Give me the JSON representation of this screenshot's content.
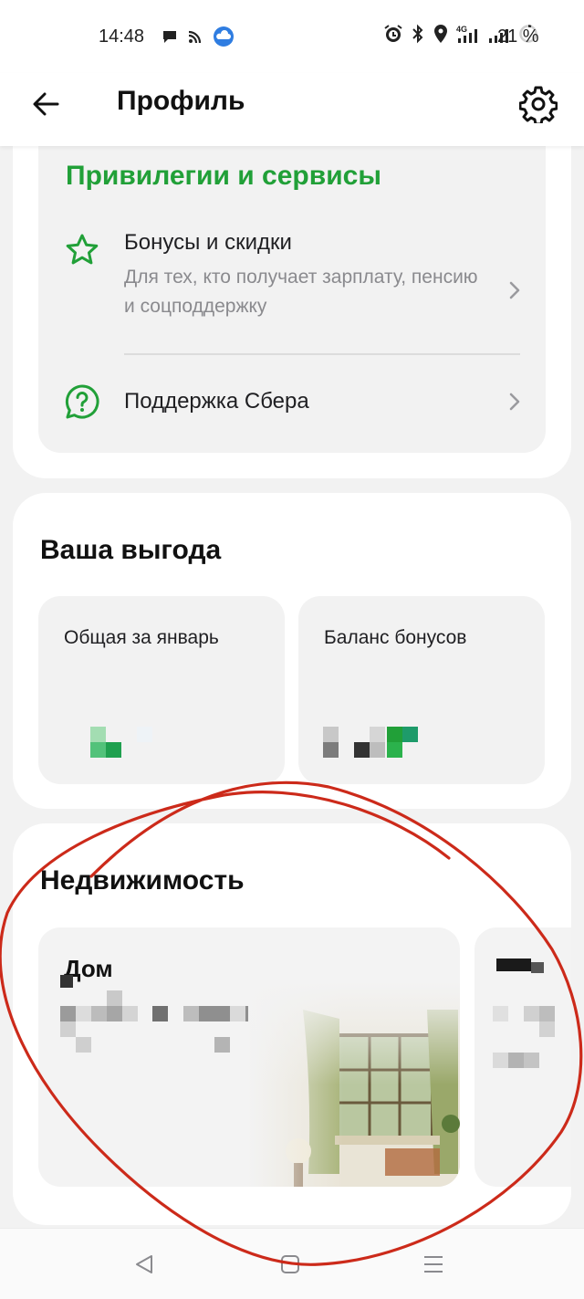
{
  "status_bar": {
    "time": "14:48",
    "battery": "21 %",
    "icons": [
      "message-icon",
      "cast-icon",
      "weather-icon",
      "alarm-icon",
      "bluetooth-icon",
      "location-icon",
      "signal-4g-icon",
      "signal-icon",
      "battery-icon"
    ]
  },
  "header": {
    "title": "Профиль",
    "back_icon": "arrow-left-icon",
    "settings_icon": "gear-icon"
  },
  "privileges": {
    "title": "Привилегии и сервисы",
    "items": [
      {
        "title": "Бонусы и скидки",
        "subtitle": "Для тех, кто получает зарплату, пенсию и соцподдержку",
        "icon": "star-icon"
      },
      {
        "title": "Поддержка Сбера",
        "icon": "question-chat-icon"
      }
    ]
  },
  "benefit": {
    "title": "Ваша выгода",
    "tiles": [
      {
        "label": "Общая за январь"
      },
      {
        "label": "Баланс бонусов"
      }
    ]
  },
  "real_estate": {
    "title": "Недвижимость",
    "cards": [
      {
        "title": "Дом"
      }
    ]
  },
  "nav": {
    "back_icon": "triangle-back-icon",
    "home_icon": "square-home-icon",
    "menu_icon": "menu-lines-icon"
  },
  "colors": {
    "brand_green": "#21a038",
    "annotation_red": "#cc2a1a",
    "page_bg": "#f2f2f2"
  }
}
